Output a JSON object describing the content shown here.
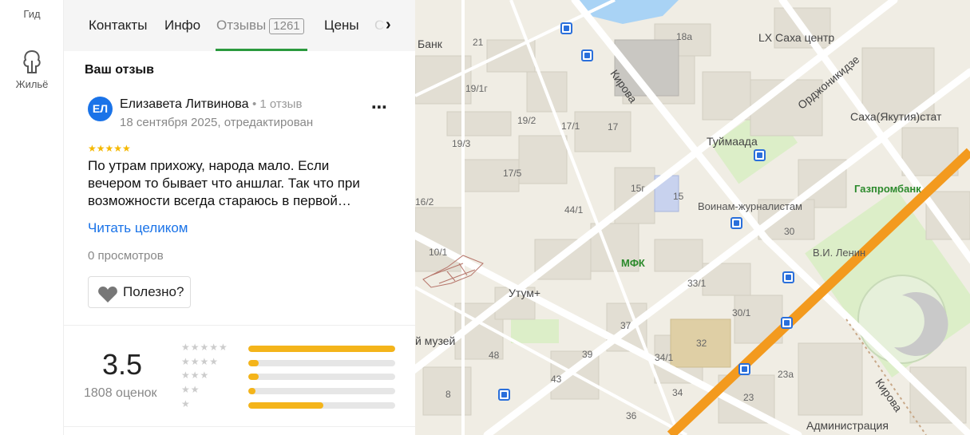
{
  "rail": {
    "gid_label": "Гид",
    "home_label": "Жильё"
  },
  "tabs": [
    {
      "label": "Контакты"
    },
    {
      "label": "Инфо"
    },
    {
      "label": "Отзывы",
      "count": "1261"
    },
    {
      "label": "Цены"
    },
    {
      "label": "С"
    }
  ],
  "review": {
    "section_title": "Ваш отзыв",
    "avatar_initials": "ЕЛ",
    "author_name": "Елизавета Литвинова",
    "author_meta": "• 1 отзыв",
    "date": "18 сентября 2025, отредактирован",
    "stars": "★★★★★",
    "rating_value": 5,
    "text": "По утрам прихожу, народа мало. Если вечером то бывает что аншлаг. Так что при возможности всегда стараюсь в первой…",
    "read_more": "Читать целиком",
    "views": "0 просмотров",
    "useful_label": "Полезно?",
    "more_icon": "more-dots-icon"
  },
  "summary": {
    "rating": "3.5",
    "count_label": "1808 оценок",
    "distribution": [
      {
        "stars": "★★★★★",
        "fraction": 1.0
      },
      {
        "stars": "★★★★",
        "fraction": 0.07
      },
      {
        "stars": "★★★",
        "fraction": 0.07
      },
      {
        "stars": "★★",
        "fraction": 0.05
      },
      {
        "stars": "★",
        "fraction": 0.51
      }
    ]
  },
  "colors": {
    "accent_green": "#2b9a3e",
    "link_blue": "#1a73e8",
    "star_yellow": "#f4b41a",
    "road_orange": "#f39a1e"
  },
  "map": {
    "labels": {
      "bank": "Банк",
      "lx": "LX Саха центр",
      "kirova1": "Кирова",
      "ordzhonikidze": "Орджоникидзе",
      "sakhastat": "Саха(Якутия)стат",
      "tuymaada": "Туймаада",
      "gazprombank": "Газпромбанк",
      "voinam": "Воинам-журналистам",
      "lenin": "В.И. Ленин",
      "mfk": "МФК",
      "utum": "Утум+",
      "muzey": "й музей",
      "kirova2": "Кирова",
      "admin": "Администрация"
    },
    "numbers": [
      "21",
      "18а",
      "19/1г",
      "19/2",
      "17/1",
      "17",
      "19/3",
      "17/5",
      "15г",
      "15",
      "44/1",
      "16/2",
      "10/1",
      "33/1",
      "30/1",
      "30",
      "37",
      "32",
      "39",
      "34/1",
      "43",
      "48",
      "8",
      "34",
      "23",
      "23а",
      "36"
    ]
  }
}
